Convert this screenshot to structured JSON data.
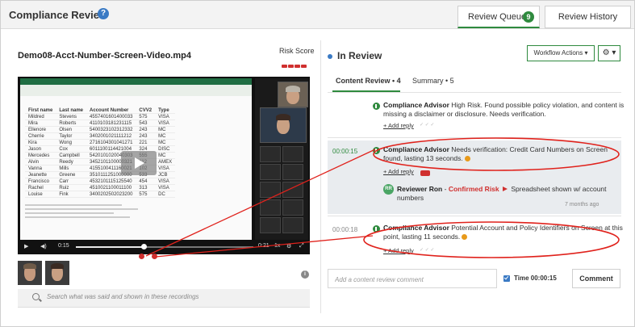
{
  "app": {
    "title": "Compliance Review",
    "help_symbol": "?"
  },
  "header_tabs": {
    "queue_label": "Review Queue",
    "queue_count": "9",
    "history_label": "Review History"
  },
  "media": {
    "file_name": "Demo08-Acct-Number-Screen-Video.mp4",
    "risk_score_label": "Risk Score",
    "risk_level_bars": 4,
    "player": {
      "current_time": "0:15",
      "duration": "0:21",
      "speed": "1x",
      "progress": 0.38
    },
    "spreadsheet": {
      "headers": [
        "First name",
        "Last name",
        "Account Number",
        "CVV2",
        "Type"
      ],
      "rows": [
        [
          "Mildred",
          "Stevens",
          "4557401601400033",
          "575",
          "VISA"
        ],
        [
          "Mira",
          "Roberts",
          "4110103181231115",
          "543",
          "VISA"
        ],
        [
          "Ellenore",
          "Olsen",
          "5400323102312332",
          "243",
          "MC"
        ],
        [
          "Cherrie",
          "Taylor",
          "3402001021111212",
          "243",
          "MC"
        ],
        [
          "Kira",
          "Wong",
          "2716104301041271",
          "221",
          "MC"
        ],
        [
          "Jason",
          "Cox",
          "6011100114421004",
          "324",
          "DISC"
        ],
        [
          "Mercedes",
          "Campbell",
          "5420101020040303",
          "555",
          "MC"
        ],
        [
          "Alvin",
          "Reedy",
          "3452101100000321",
          "112",
          "AMEX"
        ],
        [
          "Vanna",
          "Mills",
          "4155100411160021",
          "102",
          "VISA"
        ],
        [
          "Jeanette",
          "Greene",
          "3510111251000000",
          "533",
          "JCB"
        ],
        [
          "Francisco",
          "Carr",
          "4532101115125540",
          "454",
          "VISA"
        ],
        [
          "Rachel",
          "Ruiz",
          "4510021100011100",
          "313",
          "VISA"
        ],
        [
          "Louise",
          "Fink",
          "3400202502023200",
          "575",
          "DC"
        ]
      ]
    }
  },
  "search": {
    "placeholder": "Search what was said and shown in these recordings"
  },
  "review": {
    "status": "In Review",
    "workflow_label": "Workflow Actions",
    "workflow_caret": "▾",
    "gear_symbol": "⚙ ▾",
    "tabs": {
      "content_review": "Content Review • 4",
      "summary": "Summary • 5"
    },
    "items": [
      {
        "timestamp": "",
        "author": "Compliance Advisor",
        "text": "High Risk. Found possible policy violation, and content is missing a disclaimer or disclosure. Needs verification.",
        "add_reply": "+ Add reply"
      },
      {
        "timestamp": "00:00:15",
        "author": "Compliance Advisor",
        "text": "Needs verification: Credit Card Numbers on Screen found, lasting 13 seconds.",
        "add_reply": "+ Add reply",
        "reply": {
          "initials": "RR",
          "name": "Reviewer Ron",
          "separator": "-",
          "decision": "Confirmed Risk",
          "note": "Spreadsheet shown w/ account numbers",
          "time_ago": "7 months ago"
        }
      },
      {
        "timestamp": "00:00:18",
        "author": "Compliance Advisor",
        "text": "Potential Account and Policy Identifiers on Screen at this point, lasting 11 seconds.",
        "add_reply": "+ Add reply"
      }
    ],
    "comment": {
      "placeholder": "Add a content review comment",
      "time_label": "Time 00:00:15",
      "button": "Comment"
    }
  },
  "colors": {
    "accent_green": "#2f8a3e",
    "risk_red": "#d0302f",
    "link_blue": "#3a7ac4",
    "warning_orange": "#e89a1b",
    "annotation_red": "#e0221c"
  },
  "icons": [
    "help-icon",
    "settings-gear-icon",
    "compliance-advisor-icon",
    "warning-icon",
    "flag-icon",
    "play-icon",
    "volume-icon",
    "fullscreen-icon",
    "info-icon",
    "search-icon",
    "checkbox-icon"
  ]
}
